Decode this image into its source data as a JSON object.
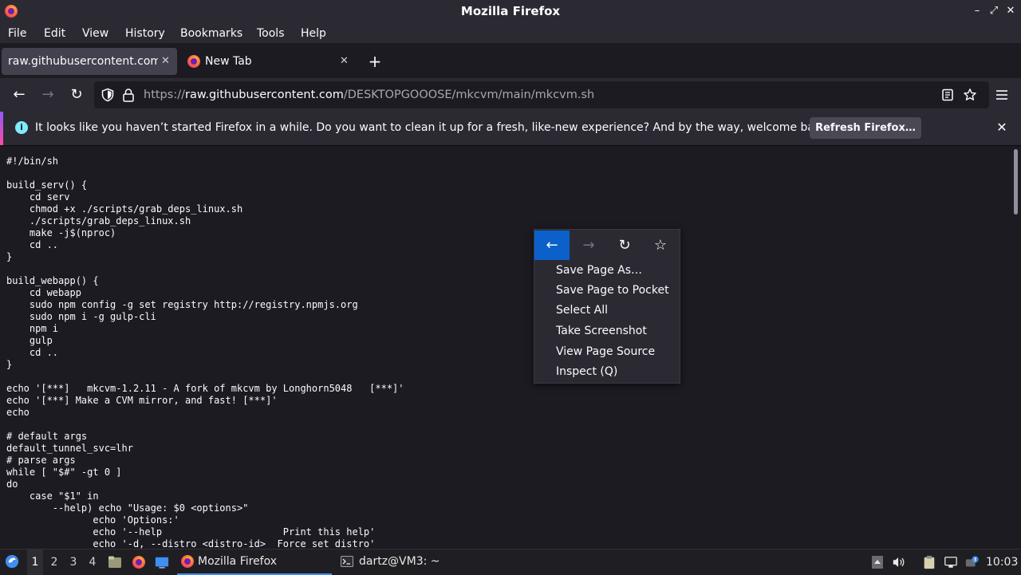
{
  "window": {
    "title": "Mozilla Firefox",
    "minimize": "–",
    "maximize": "⤢",
    "close": "✕"
  },
  "menu": [
    "File",
    "Edit",
    "View",
    "History",
    "Bookmarks",
    "Tools",
    "Help"
  ],
  "tabs": [
    {
      "label": "raw.githubusercontent.com/DESKTOPGOOOSE/mkcvm/main/mkcvm.sh",
      "close": "✕"
    },
    {
      "label": "New Tab",
      "close": "✕"
    }
  ],
  "new_tab_button": "+",
  "nav": {
    "back": "←",
    "forward": "→",
    "reload": "↻"
  },
  "url": {
    "scheme": "https://",
    "host": "raw.githubusercontent.com",
    "path": "/DESKTOPGOOOSE/mkcvm/main/mkcvm.sh"
  },
  "notification": {
    "message": "It looks like you haven’t started Firefox in a while. Do you want to clean it up for a fresh, like-new experience? And by the way, welcome back!",
    "button": "Refresh Firefox…",
    "info": "i",
    "close": "✕"
  },
  "source_text": "#!/bin/sh\n\nbuild_serv() {\n    cd serv\n    chmod +x ./scripts/grab_deps_linux.sh\n    ./scripts/grab_deps_linux.sh\n    make -j$(nproc)\n    cd ..\n}\n\nbuild_webapp() {\n    cd webapp\n    sudo npm config -g set registry http://registry.npmjs.org\n    sudo npm i -g gulp-cli\n    npm i\n    gulp\n    cd ..\n}\n\necho '[***]   mkcvm-1.2.11 - A fork of mkcvm by Longhorn5048   [***]'\necho '[***] Make a CVM mirror, and fast! [***]'\necho\n\n# default args\ndefault_tunnel_svc=lhr\n# parse args\nwhile [ \"$#\" -gt 0 ]\ndo\n    case \"$1\" in\n        --help) echo \"Usage: $0 <options>\"\n               echo 'Options:'\n               echo '--help                     Print this help'\n               echo '-d, --distro <distro-id>  Force set distro'",
  "context_menu": {
    "nav": {
      "back": "←",
      "forward": "→",
      "reload": "↻",
      "bookmark": "☆"
    },
    "items": [
      "Save Page As…",
      "Save Page to Pocket",
      "Select All",
      "Take Screenshot",
      "View Page Source",
      "Inspect (Q)"
    ]
  },
  "taskbar": {
    "workspaces": [
      "1",
      "2",
      "3",
      "4"
    ],
    "tasks": [
      "Mozilla Firefox",
      "dartz@VM3: ~"
    ],
    "clock": "10:03"
  }
}
